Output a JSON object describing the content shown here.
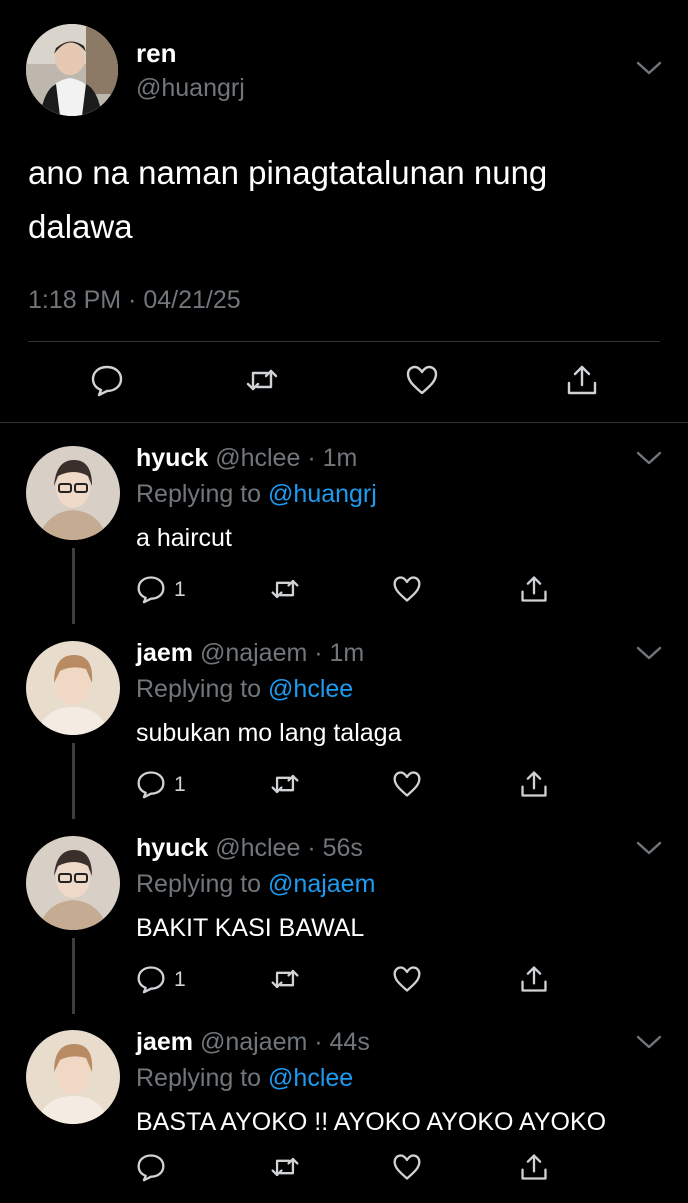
{
  "main_tweet": {
    "name": "ren",
    "handle": "@huangrj",
    "text": "ano na naman pinagtatalunan nung dalawa",
    "time": "1:18 PM",
    "date_sep": " · ",
    "date": "04/21/25"
  },
  "replies": [
    {
      "name": "hyuck",
      "handle": "@hclee",
      "age": "1m",
      "replying_prefix": "Replying to ",
      "replying_to": "@huangrj",
      "text": "a haircut",
      "reply_count": "1"
    },
    {
      "name": "jaem",
      "handle": "@najaem",
      "age": "1m",
      "replying_prefix": "Replying to ",
      "replying_to": "@hclee",
      "text": "subukan mo lang talaga",
      "reply_count": "1"
    },
    {
      "name": "hyuck",
      "handle": "@hclee",
      "age": "56s",
      "replying_prefix": "Replying to ",
      "replying_to": "@najaem",
      "text": "BAKIT KASI BAWAL",
      "reply_count": "1"
    },
    {
      "name": "jaem",
      "handle": "@najaem",
      "age": "44s",
      "replying_prefix": "Replying to ",
      "replying_to": "@hclee",
      "text": "BASTA AYOKO !! AYOKO AYOKO AYOKO",
      "reply_count": ""
    }
  ],
  "separator_dot": " · ",
  "colors": {
    "background": "#000000",
    "primary_text": "#ffffff",
    "secondary_text": "#71767b",
    "mention": "#1d9bf0",
    "divider": "#2f3336"
  },
  "icons": [
    "chevron-down-icon",
    "reply-icon",
    "retweet-icon",
    "like-icon",
    "share-icon"
  ]
}
